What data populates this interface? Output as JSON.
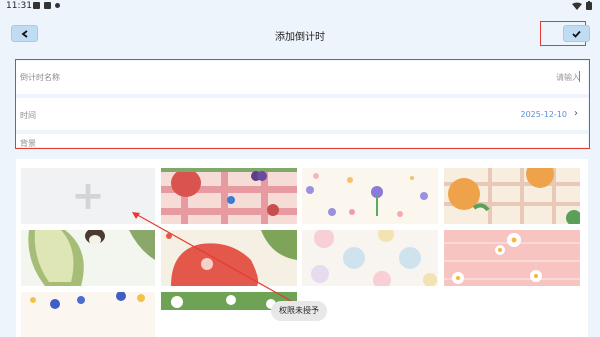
{
  "status_bar": {
    "time": "11:31"
  },
  "header": {
    "title": "添加倒计时",
    "back_icon": "back-arrow-icon",
    "confirm_icon": "checkmark-icon"
  },
  "form": {
    "name_label": "倒计时名称",
    "name_placeholder": "请输入",
    "time_label": "时间",
    "date_value": "2025-12-10",
    "background_label": "背景"
  },
  "backgrounds": [
    {
      "name": "add-background",
      "icon": "plus-icon"
    },
    {
      "name": "strawberry-lattice"
    },
    {
      "name": "purple-flowers"
    },
    {
      "name": "orange-lattice"
    },
    {
      "name": "avocado-cat"
    },
    {
      "name": "red-flower-green-leaves"
    },
    {
      "name": "pastel-dots"
    },
    {
      "name": "daisy-pink-stripes"
    },
    {
      "name": "blue-flowers"
    },
    {
      "name": "white-flowers-green"
    }
  ],
  "toast": "权限未授予",
  "colors": {
    "highlight_outline": "#e53935",
    "date_text": "#5b8fd6",
    "nav_button": "#bfdcf2"
  }
}
